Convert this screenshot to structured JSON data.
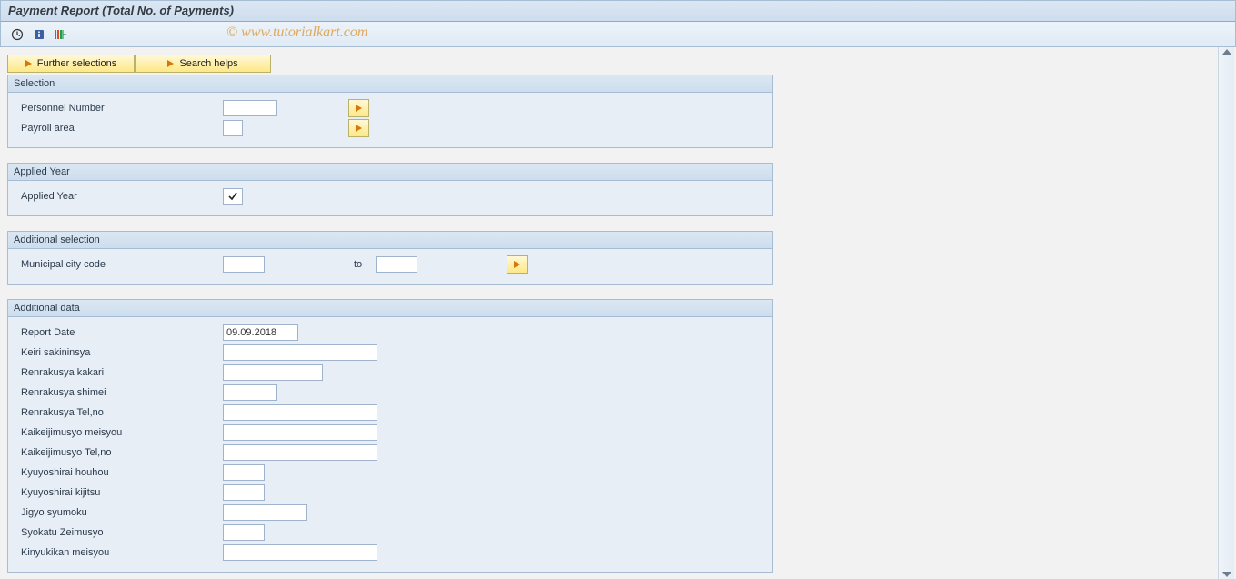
{
  "header": {
    "title": "Payment Report (Total No. of Payments)"
  },
  "watermark": "© www.tutorialkart.com",
  "toolbar_buttons": {
    "further_selections": "Further selections",
    "search_helps": "Search helps"
  },
  "groups": {
    "selection": {
      "title": "Selection",
      "personnel_number": {
        "label": "Personnel Number",
        "value": ""
      },
      "payroll_area": {
        "label": "Payroll area",
        "value": ""
      }
    },
    "applied_year": {
      "title": "Applied Year",
      "applied_year": {
        "label": "Applied Year",
        "checked": true
      }
    },
    "additional_selection": {
      "title": "Additional selection",
      "municipal_city_code": {
        "label": "Municipal city code",
        "from": "",
        "to_label": "to",
        "to": ""
      }
    },
    "additional_data": {
      "title": "Additional data",
      "rows": [
        {
          "key": "report_date",
          "label": "Report Date",
          "value": "09.09.2018",
          "w": "w-date"
        },
        {
          "key": "keiri_sakininsya",
          "label": "Keiri sakininsya",
          "value": "",
          "w": "w-lg"
        },
        {
          "key": "renrakusya_kakari",
          "label": "Renrakusya kakari",
          "value": "",
          "w": "w-mid"
        },
        {
          "key": "renrakusya_shimei",
          "label": "Renrakusya shimei",
          "value": "",
          "w": "w-sm"
        },
        {
          "key": "renrakusya_telno",
          "label": "Renrakusya Tel,no",
          "value": "",
          "w": "w-lg"
        },
        {
          "key": "kaikeijimusyo_meisyou",
          "label": "Kaikeijimusyo meisyou",
          "value": "",
          "w": "w-lg"
        },
        {
          "key": "kaikeijimusyo_telno",
          "label": "Kaikeijimusyo Tel,no",
          "value": "",
          "w": "w-lg"
        },
        {
          "key": "kyuyoshirai_houhou",
          "label": "Kyuyoshirai houhou",
          "value": "",
          "w": "w-md"
        },
        {
          "key": "kyuyoshirai_kijitsu",
          "label": "Kyuyoshirai kijitsu",
          "value": "",
          "w": "w-md"
        },
        {
          "key": "jigyo_syumoku",
          "label": "Jigyo syumoku",
          "value": "",
          "w": "w-m2"
        },
        {
          "key": "syokatu_zeimusyo",
          "label": "Syokatu Zeimusyo",
          "value": "",
          "w": "w-md"
        },
        {
          "key": "kinyukikan_meisyou",
          "label": "Kinyukikan meisyou",
          "value": "",
          "w": "w-lg"
        }
      ]
    }
  }
}
